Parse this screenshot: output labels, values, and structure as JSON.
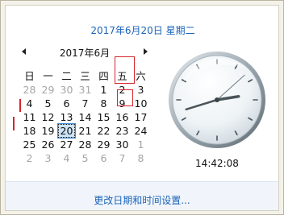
{
  "header": {
    "full_date": "2017年6月20日 星期二"
  },
  "calendar": {
    "month_title": "2017年6月",
    "weekdays": [
      "日",
      "一",
      "二",
      "三",
      "四",
      "五",
      "六"
    ],
    "weeks": [
      [
        "28",
        "29",
        "30",
        "31",
        "1",
        "2",
        "3"
      ],
      [
        "4",
        "5",
        "6",
        "7",
        "8",
        "9",
        "10"
      ],
      [
        "11",
        "12",
        "13",
        "14",
        "15",
        "16",
        "17"
      ],
      [
        "18",
        "19",
        "20",
        "21",
        "22",
        "23",
        "24"
      ],
      [
        "25",
        "26",
        "27",
        "28",
        "29",
        "30",
        "1"
      ],
      [
        "2",
        "3",
        "4",
        "5",
        "6",
        "7",
        "8"
      ]
    ],
    "selected_day": "20"
  },
  "clock": {
    "time": "14:42:08",
    "hour": 14,
    "minute": 42,
    "second": 8
  },
  "footer": {
    "settings_link": "更改日期和时间设置..."
  },
  "colors": {
    "link": "#1a63b8",
    "annotation": "#d6262b",
    "selection": "#cde4f7"
  }
}
